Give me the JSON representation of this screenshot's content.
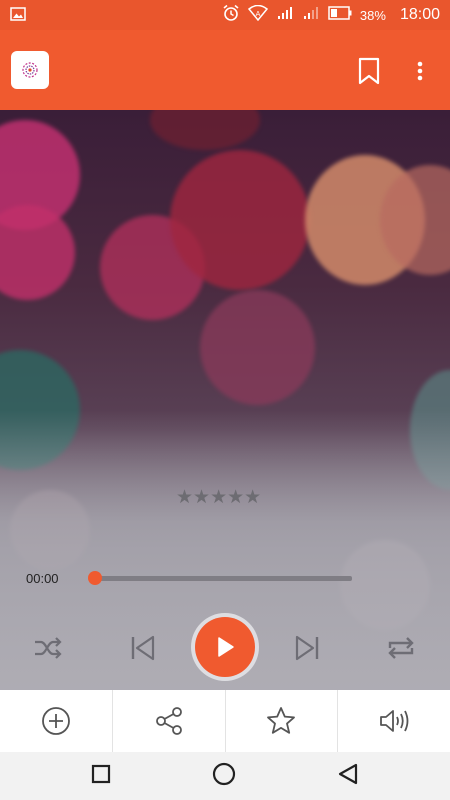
{
  "status_bar": {
    "battery_percent": "38%",
    "time": "18:00",
    "icons": [
      "image-icon",
      "alarm-icon",
      "wifi-icon",
      "signal-icon",
      "signal-icon-2",
      "battery-icon"
    ]
  },
  "app_bar": {
    "logo_icon": "app-logo-icon",
    "bookmark_icon": "bookmark-icon",
    "menu_icon": "more-vert-icon",
    "accent": "#f05a2f"
  },
  "player": {
    "rating_stars": 5,
    "rating_value": 0,
    "rating_glyphs": "★★★★★",
    "elapsed": "00:00",
    "progress": 0,
    "controls": [
      "shuffle-icon",
      "previous-icon",
      "play-icon",
      "next-icon",
      "repeat-icon"
    ]
  },
  "actions": [
    "add-icon",
    "share-icon",
    "favorite-icon",
    "volume-icon"
  ],
  "nav": [
    "recents-icon",
    "home-icon",
    "back-icon"
  ]
}
